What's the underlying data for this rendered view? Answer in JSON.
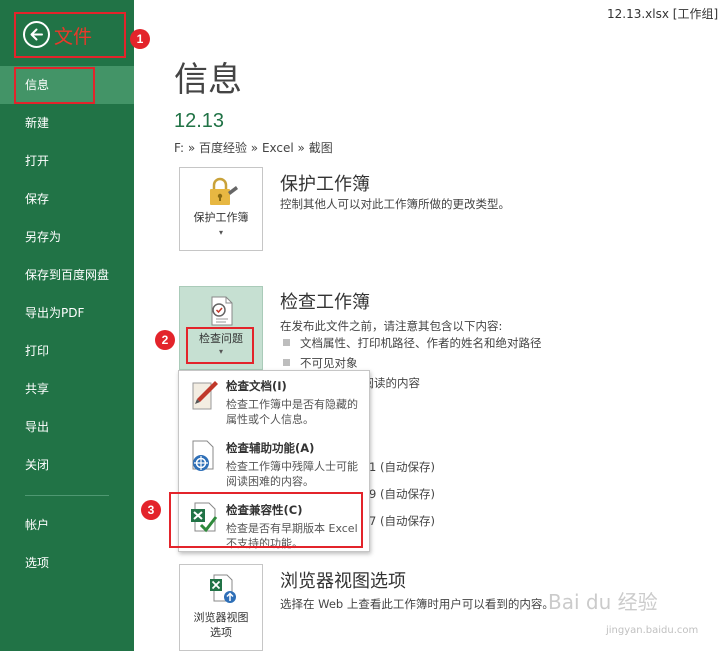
{
  "titlebar": {
    "text": "12.13.xlsx  [工作组] -"
  },
  "sidebar": {
    "back_label": "文件",
    "items": [
      {
        "label": "信息"
      },
      {
        "label": "新建"
      },
      {
        "label": "打开"
      },
      {
        "label": "保存"
      },
      {
        "label": "另存为"
      },
      {
        "label": "保存到百度网盘"
      },
      {
        "label": "导出为PDF"
      },
      {
        "label": "打印"
      },
      {
        "label": "共享"
      },
      {
        "label": "导出"
      },
      {
        "label": "关闭"
      },
      {
        "label": "帐户"
      },
      {
        "label": "选项"
      }
    ],
    "active_index": 0
  },
  "main": {
    "title": "信息",
    "file_name": "12.13",
    "file_path": "F: » 百度经验 » Excel » 截图"
  },
  "protect": {
    "tile_label": "保护工作簿",
    "title": "保护工作簿",
    "desc": "控制其他人可以对此工作簿所做的更改类型。"
  },
  "inspect": {
    "tile_label": "检查问题",
    "title": "检查工作簿",
    "desc": "在发布此文件之前，请注意其包含以下内容:",
    "bullets": [
      "文档属性、打印机路径、作者的姓名和绝对路径",
      "不可见对象",
      "法阅读的内容"
    ]
  },
  "versions": [
    "1 (自动保存)",
    "9 (自动保存)",
    "7 (自动保存)"
  ],
  "dropdown": {
    "items": [
      {
        "title": "检查文档(I)",
        "desc": "检查工作簿中是否有隐藏的属性或个人信息。",
        "icon": "inspect-document-icon"
      },
      {
        "title": "检查辅助功能(A)",
        "desc": "检查工作簿中残障人士可能阅读困难的内容。",
        "icon": "accessibility-icon"
      },
      {
        "title": "检查兼容性(C)",
        "desc": "检查是否有早期版本 Excel 不支持的功能。",
        "icon": "compatibility-icon"
      }
    ]
  },
  "browser": {
    "tile_label_1": "浏览器视图",
    "tile_label_2": "选项",
    "title": "浏览器视图选项",
    "desc": "选择在 Web 上查看此工作簿时用户可以看到的内容。"
  },
  "annotations": [
    "1",
    "2",
    "3"
  ],
  "watermark": {
    "main": "Bai du 经验",
    "sub": "jingyan.baidu.com"
  },
  "colors": {
    "excel_green": "#217346",
    "active_item": "#439467",
    "annotation_red": "#e3242b",
    "title_green": "#217346"
  }
}
